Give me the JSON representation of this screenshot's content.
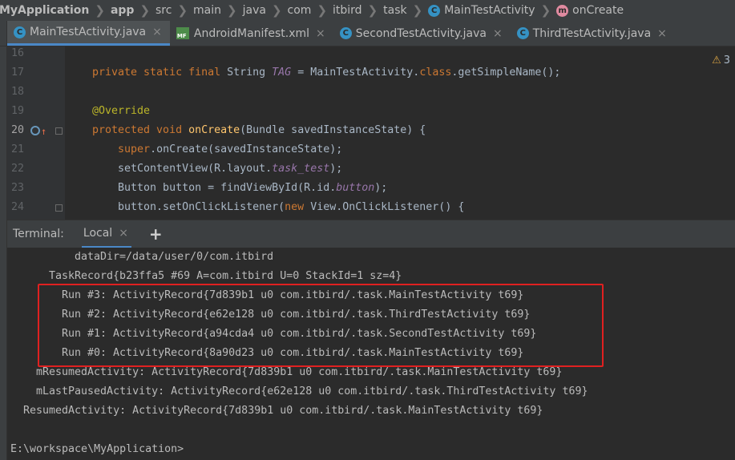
{
  "breadcrumb": [
    {
      "label": "MyApplication",
      "bold": true,
      "icon": ""
    },
    {
      "label": "app",
      "bold": true,
      "icon": ""
    },
    {
      "label": "src",
      "bold": false,
      "icon": ""
    },
    {
      "label": "main",
      "bold": false,
      "icon": ""
    },
    {
      "label": "java",
      "bold": false,
      "icon": ""
    },
    {
      "label": "com",
      "bold": false,
      "icon": ""
    },
    {
      "label": "itbird",
      "bold": false,
      "icon": ""
    },
    {
      "label": "task",
      "bold": false,
      "icon": ""
    },
    {
      "label": "MainTestActivity",
      "bold": false,
      "icon": "class-icon"
    },
    {
      "label": "onCreate",
      "bold": false,
      "icon": "method-icon"
    }
  ],
  "editor_tabs": [
    {
      "label": "MainTestActivity.java",
      "icon": "class-icon",
      "active": true
    },
    {
      "label": "AndroidManifest.xml",
      "icon": "manifest-icon",
      "active": false
    },
    {
      "label": "SecondTestActivity.java",
      "icon": "class-icon",
      "active": false
    },
    {
      "label": "ThirdTestActivity.java",
      "icon": "class-icon",
      "active": false
    }
  ],
  "icons": {
    "class_letter": "C",
    "method_letter": "m",
    "manifest_text": "MF",
    "close": "×",
    "separator": "❯"
  },
  "warnings": {
    "icon": "warning-icon",
    "count": "3"
  },
  "code_lines": [
    {
      "num": "16",
      "segments": []
    },
    {
      "num": "17",
      "segments": [
        [
          "kw",
          "private static final "
        ],
        [
          "",
          "String "
        ],
        [
          "st",
          "TAG"
        ],
        [
          "",
          " = MainTestActivity."
        ],
        [
          "kw",
          "class"
        ],
        [
          "",
          ".getSimpleName();"
        ]
      ]
    },
    {
      "num": "18",
      "segments": []
    },
    {
      "num": "19",
      "segments": [
        [
          "an",
          "@Override"
        ]
      ]
    },
    {
      "num": "20",
      "segments": [
        [
          "kw",
          "protected void "
        ],
        [
          "fn",
          "onCreate"
        ],
        [
          "",
          "(Bundle savedInstanceState) {"
        ]
      ]
    },
    {
      "num": "21",
      "segments": [
        [
          "",
          "    "
        ],
        [
          "kw",
          "super"
        ],
        [
          "",
          ".onCreate(savedInstanceState);"
        ]
      ]
    },
    {
      "num": "22",
      "segments": [
        [
          "",
          "    setContentView(R.layout."
        ],
        [
          "st",
          "task_test"
        ],
        [
          "",
          ");"
        ]
      ]
    },
    {
      "num": "23",
      "segments": [
        [
          "",
          "    Button button = findViewById(R.id."
        ],
        [
          "st",
          "button"
        ],
        [
          "",
          ");"
        ]
      ]
    },
    {
      "num": "24",
      "segments": [
        [
          "",
          "    button.setOnClickListener("
        ],
        [
          "nw",
          "new "
        ],
        [
          "",
          "View.OnClickListener() {"
        ]
      ]
    }
  ],
  "terminal": {
    "title": "Terminal:",
    "tab_label": "Local",
    "add_label": "+",
    "lines": [
      {
        "indent": 84,
        "text": "dataDir=/data/user/0/com.itbird"
      },
      {
        "indent": 52,
        "text": "TaskRecord{b23ffa5 #69 A=com.itbird U=0 StackId=1 sz=4}"
      },
      {
        "indent": 68,
        "text": "Run #3: ActivityRecord{7d839b1 u0 com.itbird/.task.MainTestActivity t69}"
      },
      {
        "indent": 68,
        "text": "Run #2: ActivityRecord{e62e128 u0 com.itbird/.task.ThirdTestActivity t69}"
      },
      {
        "indent": 68,
        "text": "Run #1: ActivityRecord{a94cda4 u0 com.itbird/.task.SecondTestActivity t69}"
      },
      {
        "indent": 68,
        "text": "Run #0: ActivityRecord{8a90d23 u0 com.itbird/.task.MainTestActivity t69}"
      },
      {
        "indent": 36,
        "text": "mResumedActivity: ActivityRecord{7d839b1 u0 com.itbird/.task.MainTestActivity t69}"
      },
      {
        "indent": 36,
        "text": "mLastPausedActivity: ActivityRecord{e62e128 u0 com.itbird/.task.ThirdTestActivity t69}"
      },
      {
        "indent": 20,
        "text": "ResumedActivity: ActivityRecord{7d839b1 u0 com.itbird/.task.MainTestActivity t69}"
      },
      {
        "indent": 4,
        "text": ""
      },
      {
        "indent": 4,
        "text": "E:\\workspace\\MyApplication>"
      }
    ]
  },
  "colors": {
    "highlight_box": "#e02020",
    "accent": "#4a88c7"
  }
}
